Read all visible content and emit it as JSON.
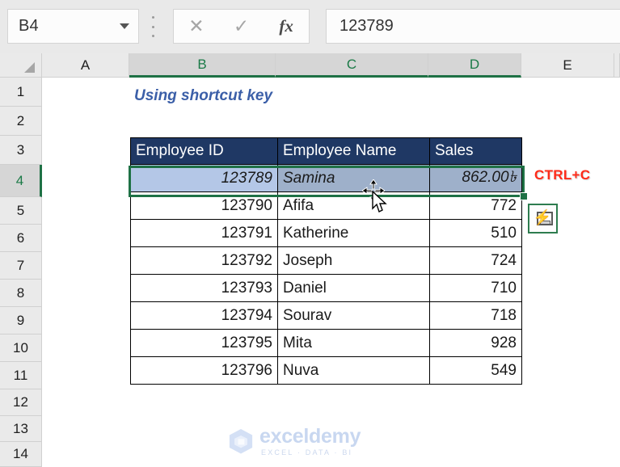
{
  "formula_bar": {
    "name_box_value": "B4",
    "cancel_icon": "close-x-icon",
    "confirm_icon": "check-icon",
    "function_icon": "fx-icon",
    "formula_value": "123789"
  },
  "columns": [
    "A",
    "B",
    "C",
    "D",
    "E"
  ],
  "rows": [
    "1",
    "2",
    "3",
    "4",
    "5",
    "6",
    "7",
    "8",
    "9",
    "10",
    "11",
    "12",
    "13",
    "14"
  ],
  "selected_columns": [
    "B",
    "C",
    "D"
  ],
  "selected_row": "4",
  "sheet": {
    "title_cell_b1": "Using shortcut key"
  },
  "table": {
    "headers": [
      "Employee ID",
      "Employee Name",
      "Sales"
    ],
    "rows": [
      {
        "id": "123789",
        "name": "Samina",
        "sales": "862.00৳",
        "selected": true
      },
      {
        "id": "123790",
        "name": "Afifa",
        "sales": "772",
        "selected": false
      },
      {
        "id": "123791",
        "name": "Katherine",
        "sales": "510",
        "selected": false
      },
      {
        "id": "123792",
        "name": "Joseph",
        "sales": "724",
        "selected": false
      },
      {
        "id": "123793",
        "name": "Daniel",
        "sales": "710",
        "selected": false
      },
      {
        "id": "123794",
        "name": "Sourav",
        "sales": "718",
        "selected": false
      },
      {
        "id": "123795",
        "name": "Mita",
        "sales": "928",
        "selected": false
      },
      {
        "id": "123796",
        "name": "Nuva",
        "sales": "549",
        "selected": false
      }
    ]
  },
  "annotation": {
    "shortcut_label": "CTRL+C",
    "shortcut_color": "#ff2b19"
  },
  "quick_analysis": {
    "icon": "quick-analysis-icon",
    "bolt": "⚡"
  },
  "cursor": {
    "icon": "move-cursor"
  },
  "watermark": {
    "brand": "exceldemy",
    "tagline": "EXCEL · DATA · BI"
  },
  "colors": {
    "header_fill": "#1f3864",
    "selection_green": "#1e7145",
    "active_cell_fill": "#b4c7e7",
    "selected_cell_fill": "#9eb0ca",
    "title_blue": "#3b5fa8"
  }
}
